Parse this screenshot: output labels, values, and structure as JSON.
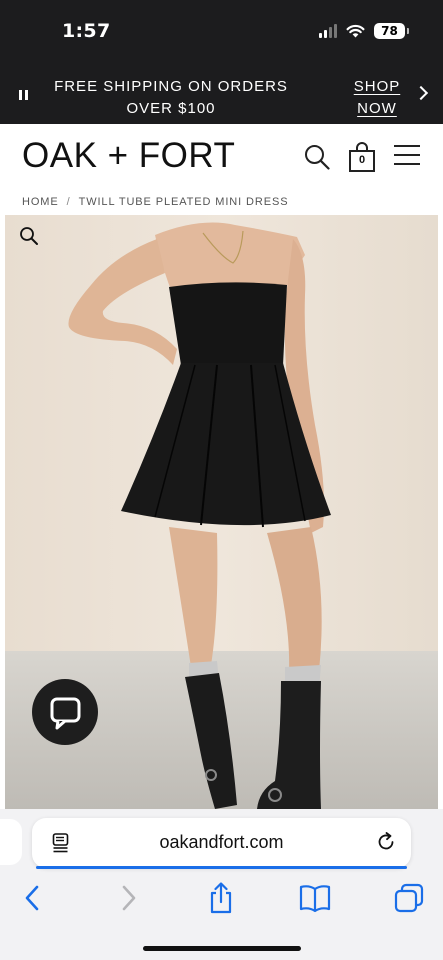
{
  "status_bar": {
    "time": "1:57",
    "battery_level": "78"
  },
  "promo_banner": {
    "message": "FREE SHIPPING ON ORDERS OVER $100",
    "cta": "SHOP NOW"
  },
  "header": {
    "logo": "OAK + FORT",
    "bag_count": "0"
  },
  "breadcrumb": {
    "home": "HOME",
    "separator": "/",
    "current": "TWILL TUBE PLEATED MINI DRESS"
  },
  "browser": {
    "url": "oakandfort.com"
  },
  "icons": {
    "pause": "pause-icon",
    "next": "chevron-right-icon",
    "search": "search-icon",
    "bag": "shopping-bag-icon",
    "menu": "hamburger-menu-icon",
    "zoom": "zoom-icon",
    "chat": "chat-icon",
    "page_menu": "page-menu-icon",
    "reload": "reload-icon",
    "back": "back-icon",
    "forward": "forward-icon",
    "share": "share-icon",
    "bookmarks": "bookmarks-icon",
    "tabs": "tabs-icon"
  },
  "colors": {
    "banner_bg": "#1c1c1e",
    "ios_blue": "#1a6ee8",
    "dress": "#151515"
  }
}
